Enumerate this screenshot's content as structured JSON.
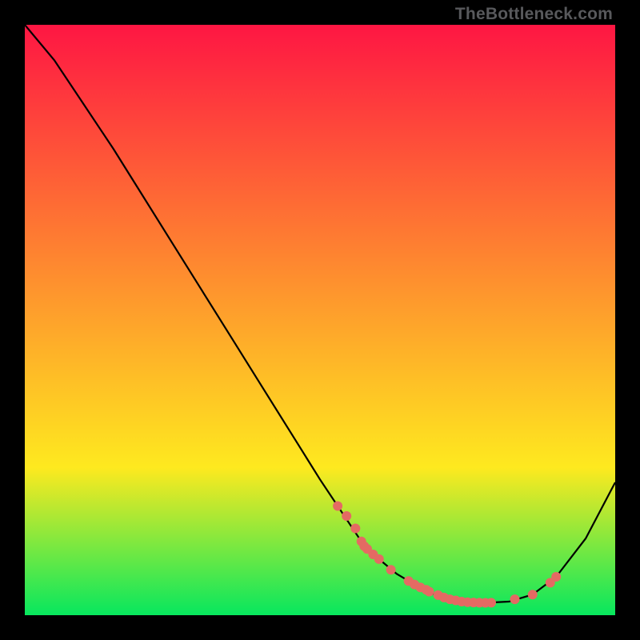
{
  "watermark": "TheBottleneck.com",
  "chart_data": {
    "type": "line",
    "title": "",
    "xlabel": "",
    "ylabel": "",
    "xlim": [
      0,
      100
    ],
    "ylim": [
      0,
      100
    ],
    "grid": false,
    "legend": false,
    "background_gradient": {
      "top": "#fe1643",
      "mid": "#fee91f",
      "bottom": "#07e75e"
    },
    "series": [
      {
        "name": "curve",
        "type": "line",
        "color": "#000000",
        "x": [
          0,
          5,
          10,
          15,
          20,
          25,
          30,
          35,
          40,
          45,
          50,
          53,
          57,
          60,
          63,
          66,
          69,
          72,
          75,
          78,
          82,
          86,
          90,
          95,
          100
        ],
        "y": [
          100,
          94,
          86.5,
          79,
          71,
          63,
          55,
          47,
          39,
          31,
          23,
          18.5,
          12.5,
          9.5,
          7,
          5.2,
          3.7,
          2.7,
          2.2,
          2.1,
          2.3,
          3.5,
          6.5,
          13,
          22.5
        ]
      },
      {
        "name": "markers",
        "type": "scatter",
        "color": "#e46a63",
        "x": [
          53,
          54.5,
          56,
          57,
          57.5,
          58,
          59,
          60,
          62,
          65,
          66,
          67,
          68,
          68.5,
          70,
          71,
          72,
          73,
          74,
          75,
          76,
          77,
          78,
          79,
          83,
          86,
          89,
          90
        ],
        "y": [
          18.5,
          16.8,
          14.7,
          12.5,
          11.7,
          11.2,
          10.3,
          9.5,
          7.7,
          5.8,
          5.2,
          4.7,
          4.3,
          4.0,
          3.4,
          3.0,
          2.7,
          2.5,
          2.3,
          2.2,
          2.15,
          2.12,
          2.1,
          2.12,
          2.7,
          3.5,
          5.5,
          6.5
        ]
      }
    ]
  }
}
